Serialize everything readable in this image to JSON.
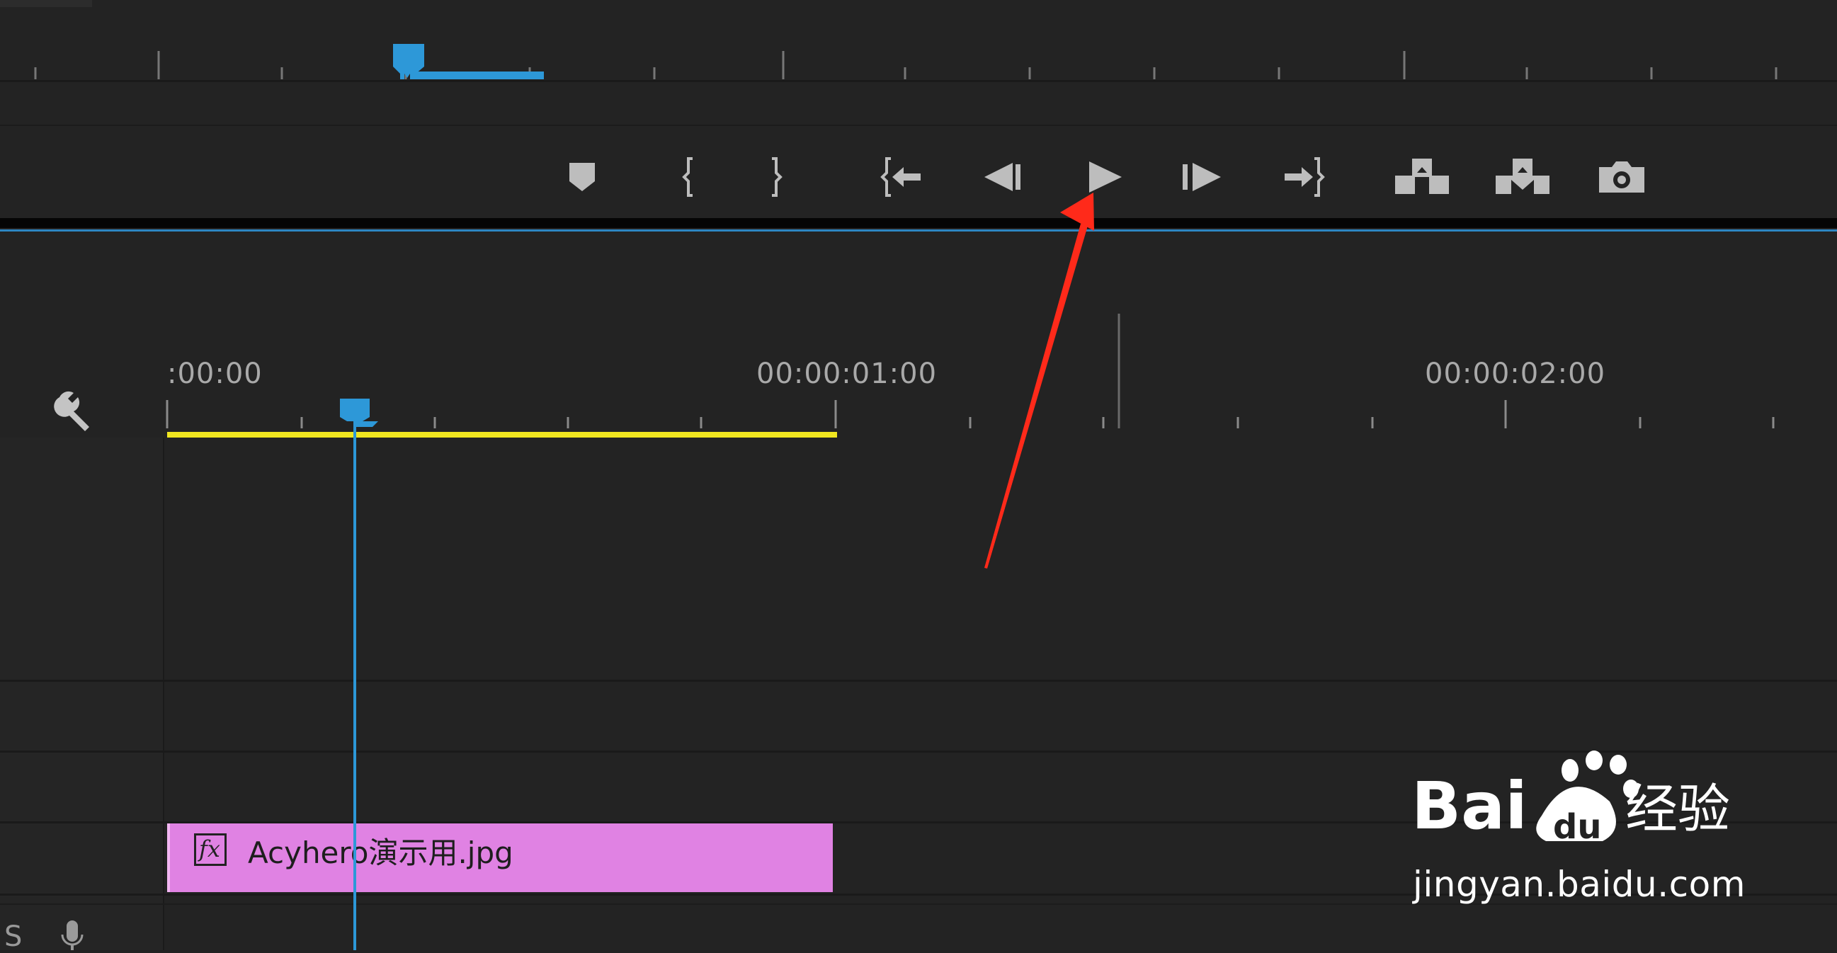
{
  "monitor": {
    "controls": [
      {
        "name": "add-marker-button",
        "icon": "marker-icon"
      },
      {
        "name": "mark-in-button",
        "icon": "mark-in-icon"
      },
      {
        "name": "mark-out-button",
        "icon": "mark-out-icon"
      },
      {
        "name": "go-to-in-button",
        "icon": "go-to-in-icon"
      },
      {
        "name": "step-back-button",
        "icon": "step-back-icon"
      },
      {
        "name": "play-button",
        "icon": "play-icon"
      },
      {
        "name": "step-forward-button",
        "icon": "step-forward-icon"
      },
      {
        "name": "go-to-out-button",
        "icon": "go-to-out-icon"
      },
      {
        "name": "lift-button",
        "icon": "lift-icon"
      },
      {
        "name": "extract-button",
        "icon": "extract-icon"
      },
      {
        "name": "export-frame-button",
        "icon": "camera-icon"
      }
    ]
  },
  "timeline": {
    "timecodes": [
      ":00:00",
      "00:00:01:00",
      "00:00:02:00"
    ],
    "settings_icon": "wrench-icon",
    "track_label": "S",
    "mic_icon": "microphone-icon",
    "clip": {
      "fx_label": "fx",
      "name": "Acyhero演示用.jpg",
      "color": "#e082e3"
    },
    "workarea_color": "#f0e620",
    "playhead_color": "#2d98d8"
  },
  "annotation": {
    "arrow_color": "#ff2a1a"
  },
  "watermark": {
    "brand": "Bai",
    "brand_suffix": "du",
    "cn_text": "经验",
    "url": "jingyan.baidu.com"
  }
}
